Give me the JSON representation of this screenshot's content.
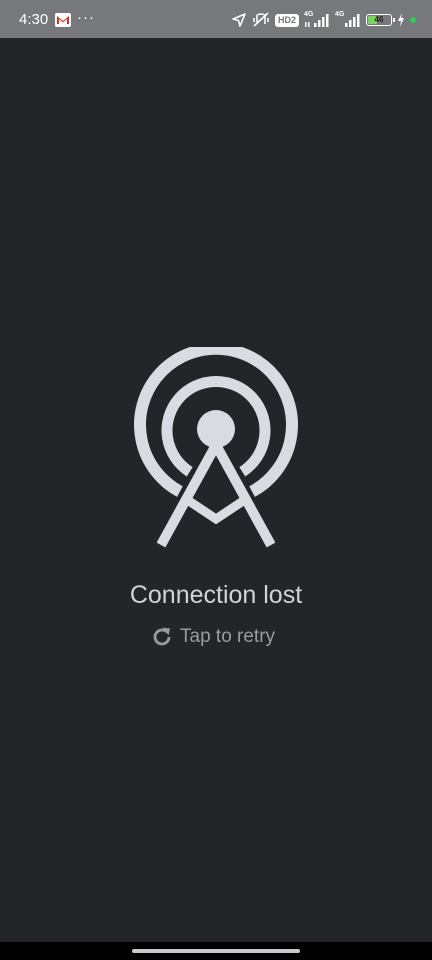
{
  "status_bar": {
    "time": "4:30",
    "more_dots": "···",
    "hd_label": "HD2",
    "signal_1_label": "4G",
    "signal_2_label": "4G",
    "battery_level": "46",
    "battery_fill_color": "#7fd35a",
    "charge_dot_color": "#34c759",
    "icons": [
      "gmail-icon",
      "location-arrow-icon",
      "vibrate-off-icon",
      "signal-icon",
      "signal-icon",
      "battery-icon",
      "bolt-icon"
    ]
  },
  "main": {
    "error_icon": "radio-tower-icon",
    "title": "Connection lost",
    "retry_label": "Tap to retry",
    "retry_icon": "refresh-icon",
    "icon_color": "#d9dbe2",
    "background_color": "#242529"
  }
}
